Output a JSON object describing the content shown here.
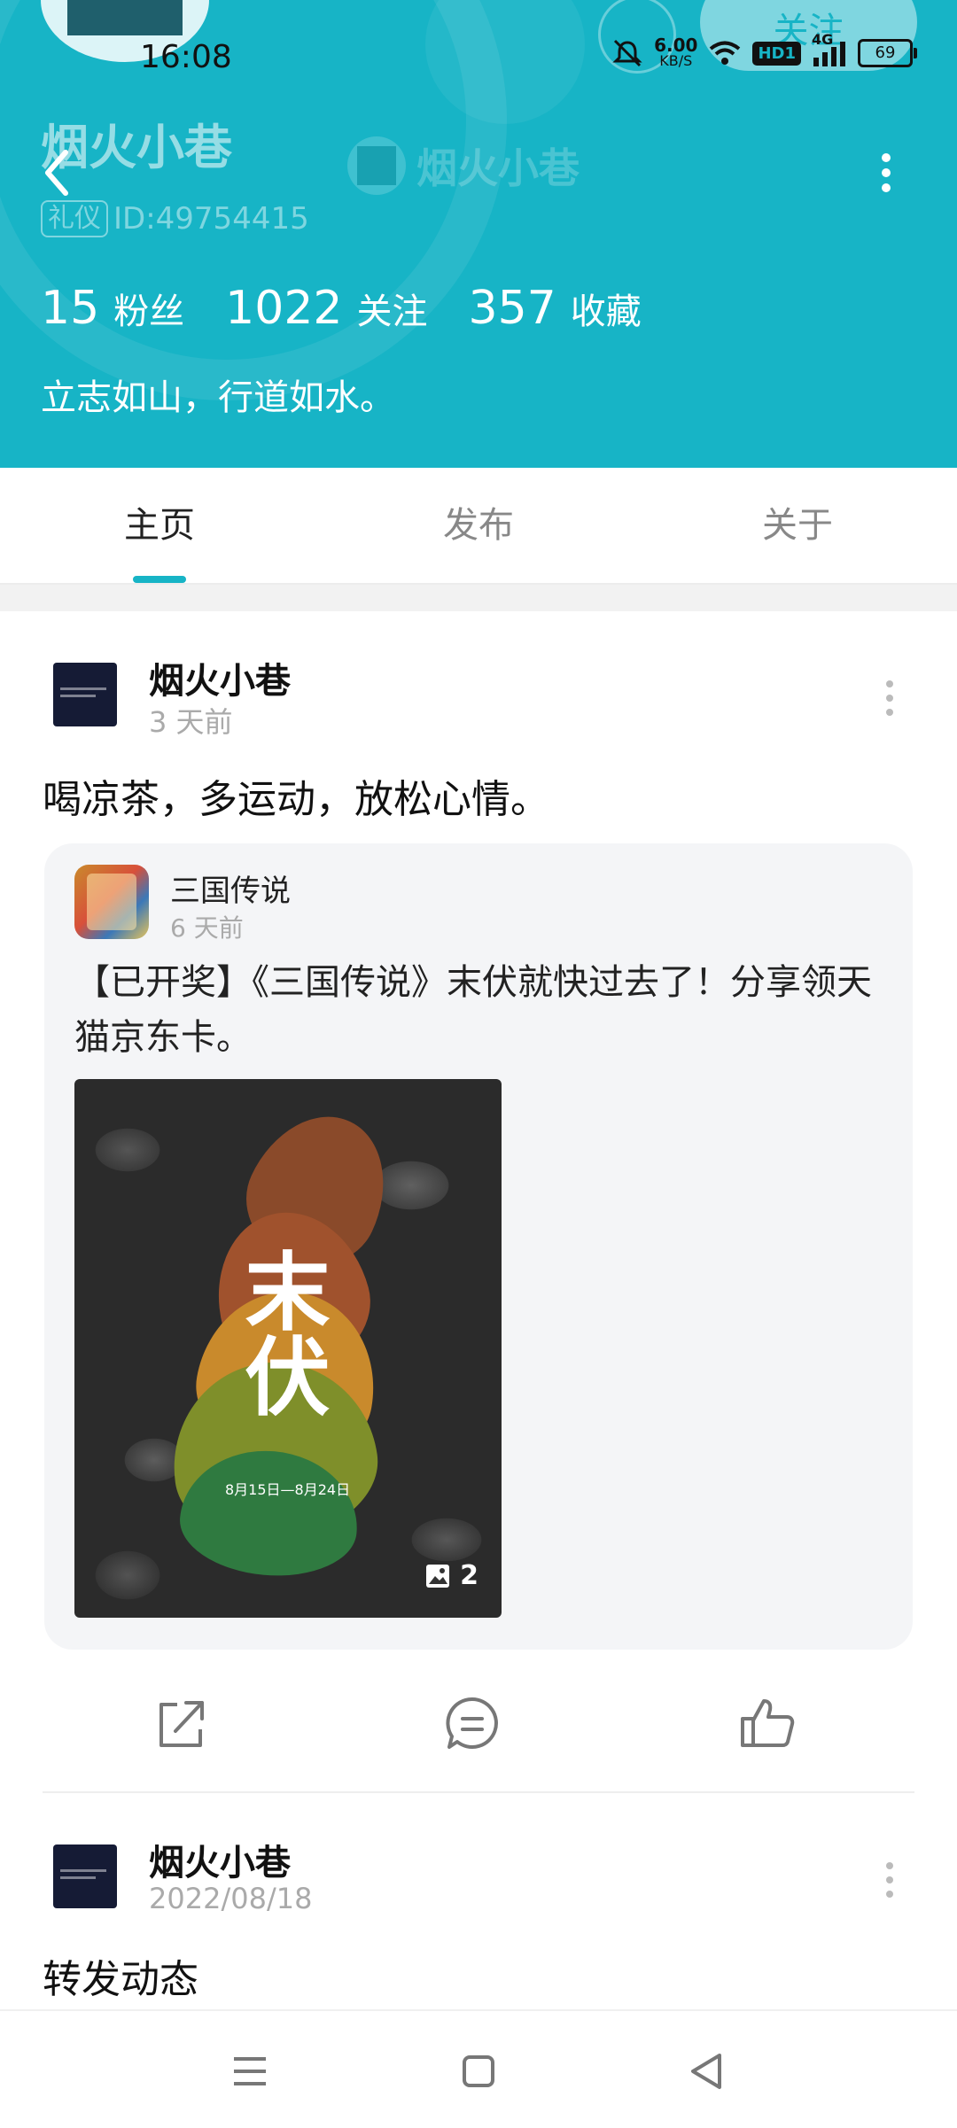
{
  "status_bar": {
    "time": "16:08",
    "net_speed": "6.00",
    "net_unit": "KB/S",
    "hd_label": "HD1",
    "signal_label": "4G",
    "battery": "69"
  },
  "header": {
    "follow_label": "关注",
    "title": "烟火小巷",
    "user_name": "烟火小巷",
    "badge": "礼仪",
    "user_id": "ID:49754415",
    "stats": [
      {
        "value": "15",
        "label": "粉丝"
      },
      {
        "value": "1022",
        "label": "关注"
      },
      {
        "value": "357",
        "label": "收藏"
      }
    ],
    "bio": "立志如山，行道如水。",
    "accent": "#17b4c6"
  },
  "tabs": [
    {
      "label": "主页",
      "active": true
    },
    {
      "label": "发布",
      "active": false
    },
    {
      "label": "关于",
      "active": false
    }
  ],
  "posts": [
    {
      "author": "烟火小巷",
      "time": "3 天前",
      "text": "喝凉茶，多运动，放松心情。",
      "quote": {
        "author": "三国传说",
        "time": "6 天前",
        "text": "【已开奖】《三国传说》末伏就快过去了！分享领天猫京东卡。",
        "image_title": "末伏",
        "image_subtitle": "8月15日—8月24日",
        "image_count": "2"
      }
    },
    {
      "author": "烟火小巷",
      "time": "2022/08/18",
      "text": "转发动态"
    }
  ]
}
